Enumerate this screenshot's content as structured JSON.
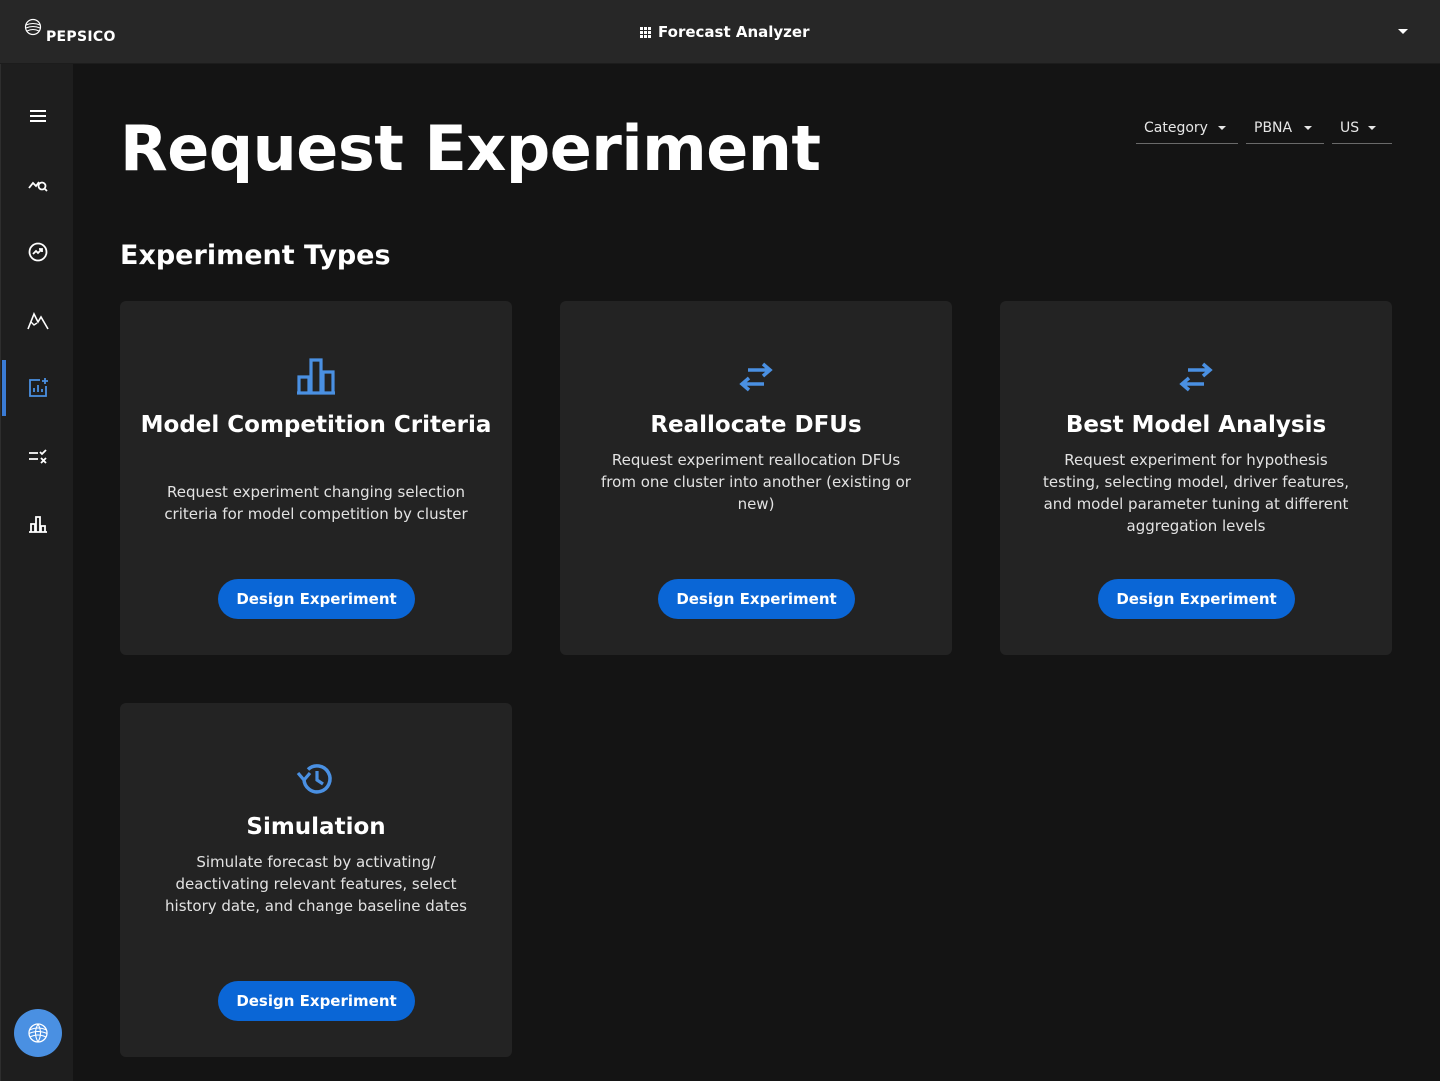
{
  "header": {
    "brand": "PEPSICO",
    "app_title": "Forecast Analyzer"
  },
  "sidebar": {
    "items": [
      {
        "icon": "menu-icon",
        "active": false
      },
      {
        "icon": "chart-search-icon",
        "active": false
      },
      {
        "icon": "trend-gauge-icon",
        "active": false
      },
      {
        "icon": "mountain-chart-icon",
        "active": false
      },
      {
        "icon": "chart-add-icon",
        "active": true
      },
      {
        "icon": "list-check-icon",
        "active": false
      },
      {
        "icon": "bar-chart-icon",
        "active": false
      }
    ]
  },
  "page": {
    "title": "Request Experiment",
    "section_title": "Experiment Types"
  },
  "filters": {
    "category": "Category",
    "region": "PBNA",
    "country": "US"
  },
  "cards": [
    {
      "icon": "bar-chart-icon",
      "title": "Model Competition Criteria",
      "description": "Request experiment changing selection criteria for model competition by cluster",
      "button": "Design Experiment"
    },
    {
      "icon": "swap-arrows-icon",
      "title": "Reallocate DFUs",
      "description": "Request experiment reallocation DFUs from one cluster into another (existing or new)",
      "button": "Design Experiment"
    },
    {
      "icon": "swap-arrows-icon",
      "title": "Best Model Analysis",
      "description": "Request experiment for hypothesis testing, selecting model, driver features, and model parameter tuning at different aggregation levels",
      "button": "Design Experiment"
    },
    {
      "icon": "history-icon",
      "title": "Simulation",
      "description": "Simulate forecast by activating/ deactivating relevant features, select history date, and change baseline dates",
      "button": "Design Experiment"
    }
  ],
  "colors": {
    "background": "#141414",
    "topbar": "#272727",
    "card": "#232323",
    "accent_icon": "#4a90e2",
    "button": "#0a66d6"
  }
}
